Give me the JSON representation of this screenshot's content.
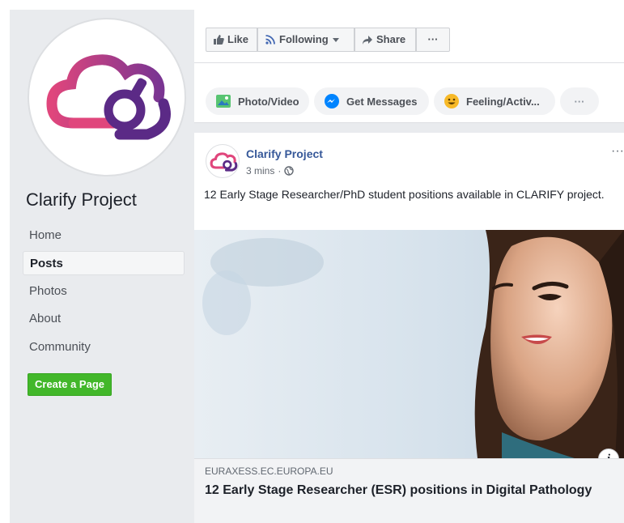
{
  "sidebar": {
    "page_name": "Clarify Project",
    "nav": [
      {
        "label": "Home"
      },
      {
        "label": "Posts"
      },
      {
        "label": "Photos"
      },
      {
        "label": "About"
      },
      {
        "label": "Community"
      }
    ],
    "create_page_label": "Create a Page"
  },
  "actions": {
    "like_label": "Like",
    "following_label": "Following",
    "share_label": "Share",
    "more_label": "···"
  },
  "composer": {
    "photo_label": "Photo/Video",
    "messages_label": "Get Messages",
    "feeling_label": "Feeling/Activ...",
    "more_label": "···"
  },
  "post": {
    "author": "Clarify Project",
    "time": "3 mins",
    "separator": "·",
    "more_label": "···",
    "text": "12 Early Stage Researcher/PhD student positions available in CLARIFY project.",
    "link": {
      "domain": "EURAXESS.EC.EUROPA.EU",
      "title": "12 Early Stage Researcher (ESR) positions in Digital Pathology"
    },
    "info_label": "i"
  },
  "colors": {
    "brand_pink": "#e0467c",
    "brand_purple": "#5b2a86",
    "link_blue": "#365899",
    "create_green": "#42b72a",
    "sidebar_bg": "#e9ebee"
  },
  "icons": [
    "like-icon",
    "rss-icon",
    "caret-down-icon",
    "share-icon",
    "photo-icon",
    "messenger-icon",
    "emoji-icon",
    "globe-icon",
    "info-icon"
  ]
}
